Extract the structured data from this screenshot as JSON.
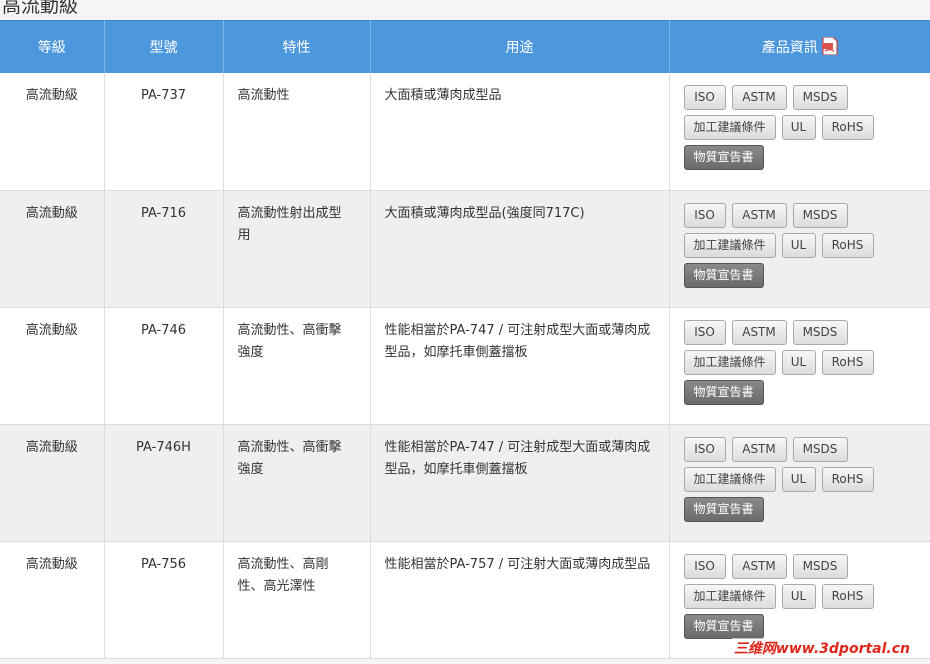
{
  "section_title": "高流動級",
  "table": {
    "headers": {
      "grade": "等級",
      "model": "型號",
      "feature": "特性",
      "use": "用途",
      "info": "產品資訊"
    },
    "buttons": {
      "iso": "ISO",
      "astm": "ASTM",
      "msds": "MSDS",
      "processing": "加工建議條件",
      "ul": "UL",
      "rohs": "RoHS",
      "declaration": "物質宣告書"
    },
    "rows": [
      {
        "grade": "高流動級",
        "model": "PA-737",
        "feature_lines": [
          "高流動性",
          ""
        ],
        "use_lines": [
          "大面積或薄肉成型品",
          ""
        ]
      },
      {
        "grade": "高流動級",
        "model": "PA-716",
        "feature_lines": [
          "高流動性射出成型",
          "用"
        ],
        "use_lines": [
          "大面積或薄肉成型品(強度同717C)",
          ""
        ]
      },
      {
        "grade": "高流動級",
        "model": "PA-746",
        "feature_lines": [
          "高流動性、高衝擊",
          "強度"
        ],
        "use_lines": [
          "性能相當於PA-747 / 可注射成型大面或薄肉成",
          "型品，如摩托車側蓋擋板"
        ]
      },
      {
        "grade": "高流動級",
        "model": "PA-746H",
        "feature_lines": [
          "高流動性、高衝擊",
          "強度"
        ],
        "use_lines": [
          "性能相當於PA-747 / 可注射成型大面或薄肉成",
          "型品，如摩托車側蓋擋板"
        ]
      },
      {
        "grade": "高流動級",
        "model": "PA-756",
        "feature_lines": [
          "高流動性、高剛",
          "性、高光澤性"
        ],
        "use_lines": [
          "性能相當於PA-757 / 可注射大面或薄肉成型品",
          ""
        ]
      }
    ]
  },
  "watermark": "三维网www.3dportal.cn",
  "colors": {
    "header_bg": "#4d97dc",
    "row_alt_bg": "#efefef",
    "dark_button": "#777777",
    "watermark": "#e0261a"
  }
}
